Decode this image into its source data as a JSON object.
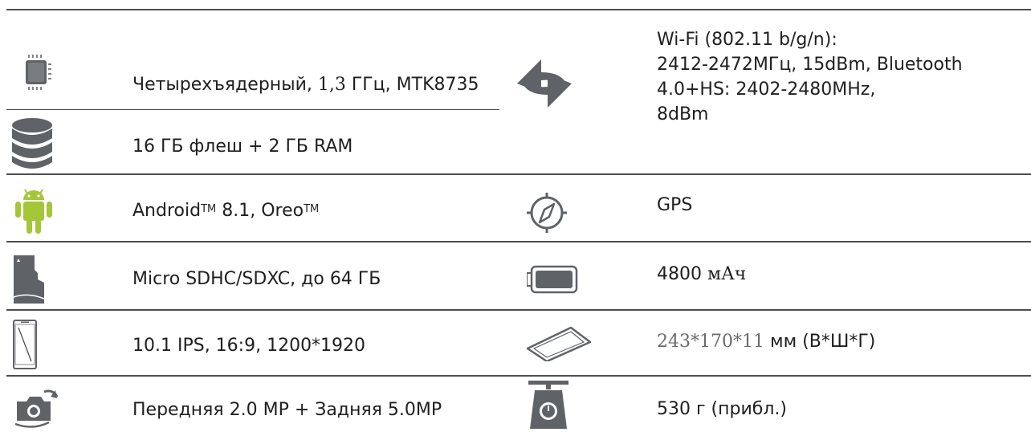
{
  "specs_left": {
    "processor": {
      "icon": "cpu-chip-icon",
      "text_a": "Четырехъядерный, ",
      "text_b": "1,3",
      "text_c": " ГГц, MTK8735"
    },
    "storage": {
      "icon": "storage-stack-icon",
      "text": "16 ГБ флеш + 2 ГБ RAM"
    },
    "os": {
      "icon": "android-icon",
      "text_a": "Android",
      "tm1": "TM",
      "text_b": " 8.1, Oreo",
      "tm2": "TM"
    },
    "memory_card": {
      "icon": "sd-card-icon",
      "text": "Micro SDHC/SDXC, до 64 ГБ"
    },
    "display": {
      "icon": "phone-display-icon",
      "text": "10.1 IPS, 16:9, 1200*1920"
    },
    "camera": {
      "icon": "camera-rotate-icon",
      "text": "Передняя 2.0 MP + Задняя 5.0MP"
    }
  },
  "specs_right": {
    "connectivity": {
      "icon": "sync-arrows-icon",
      "lines": [
        "Wi-Fi (802.11 b/g/n):",
        "2412-2472МГц, 15dBm, Bluetooth",
        "4.0+HS: 2402-2480MHz,",
        "8dBm"
      ]
    },
    "gps": {
      "icon": "compass-icon",
      "text": "GPS"
    },
    "battery": {
      "icon": "battery-icon",
      "value": "4800 ",
      "unit": "мАч"
    },
    "dimensions": {
      "icon": "tablet-slab-icon",
      "value": "243*170*11",
      "unit": " мм (В*Ш*Г)"
    },
    "weight": {
      "icon": "weight-scale-icon",
      "text": "530 г (прибл.)"
    }
  },
  "colors": {
    "rule": "#4d4d4d",
    "icon_gray": "#5f6368",
    "android_green": "#a4c639"
  }
}
